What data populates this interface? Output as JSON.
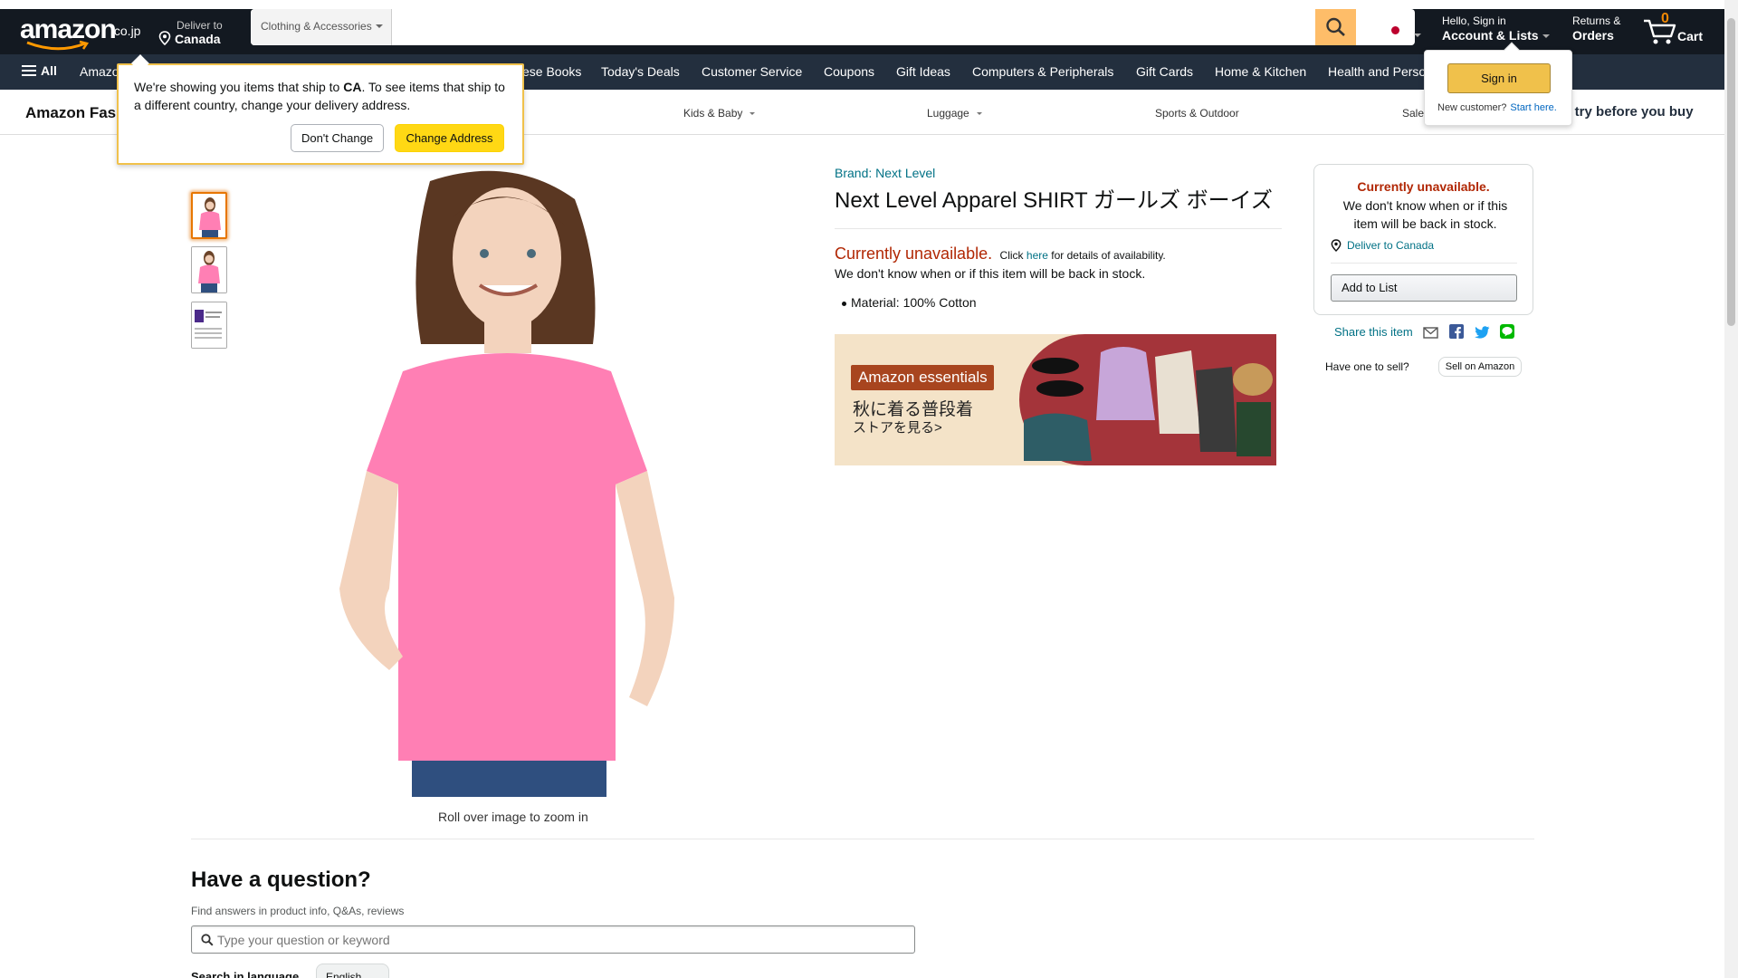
{
  "header": {
    "logo_text": "amazon",
    "logo_suffix": ".co.jp",
    "deliver_line1": "Deliver to",
    "deliver_line2": "Canada",
    "search_category": "Clothing & Accessories",
    "search_value": "",
    "account_line1": "Hello, Sign in",
    "account_line2": "Account & Lists",
    "returns_line1": "Returns &",
    "returns_line2": "Orders",
    "cart_count": "0",
    "cart_label": "Cart",
    "colors": {
      "topbar": "#131921",
      "navbar": "#232f3e",
      "accent": "#febd69"
    }
  },
  "nav": {
    "all_label": "All",
    "items": [
      "Amazon",
      "ese Books",
      "Today's Deals",
      "Customer Service",
      "Coupons",
      "Gift Ideas",
      "Computers & Peripherals",
      "Gift Cards",
      "Home & Kitchen",
      "Health and Perso"
    ]
  },
  "subnav": {
    "store_title": "Amazon Fas",
    "categories": [
      "Kids & Baby",
      "Luggage",
      "Sports & Outdoor",
      "Sale"
    ],
    "promo_prefix": "ne",
    "promo_text": " try before you buy"
  },
  "location_popover": {
    "message_pre": "We're showing you items that ship to ",
    "message_country": "CA",
    "message_post": ". To see items that ship to a different country, change your delivery address.",
    "dont_change_label": "Don't Change",
    "change_address_label": "Change Address"
  },
  "signin_flyout": {
    "button_label": "Sign in",
    "new_customer": "New customer?",
    "start_here": "Start here."
  },
  "product": {
    "brand": "Brand: Next Level",
    "title": "Next Level Apparel SHIRT ガールズ ボーイズ",
    "unavailable_big": "Currently unavailable.",
    "click_pre": "Click",
    "click_link": "here",
    "click_post": "for details of availability.",
    "unknown_restock": "We don't know when or if this item will be back in stock.",
    "bullets": [
      "Material: 100% Cotton"
    ],
    "rollover_text": "Roll over image to zoom in",
    "shirt_color": "#ff7fb4"
  },
  "banner": {
    "pill": "Amazon essentials",
    "line1": "秋に着る普段着",
    "line2": "ストアを見る>"
  },
  "buybox": {
    "unavailable": "Currently unavailable.",
    "description": "We don't know when or if this item will be back in stock.",
    "deliver_link": "Deliver to Canada",
    "add_to_list": "Add to List",
    "share_label": "Share this item",
    "have_one": "Have one to sell?",
    "sell_button": "Sell on Amazon"
  },
  "qa": {
    "heading": "Have a question?",
    "subtext": "Find answers in product info, Q&As, reviews",
    "placeholder": "Type your question or keyword",
    "language_label": "Search in language",
    "language_value": "English"
  }
}
